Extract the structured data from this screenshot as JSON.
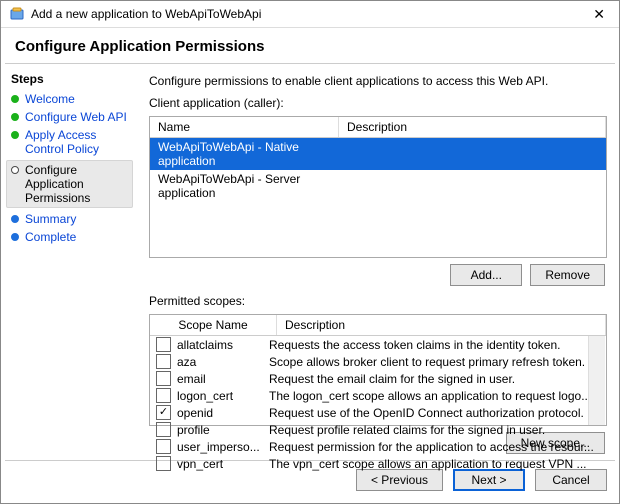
{
  "title": "Add a new application to WebApiToWebApi",
  "header": "Configure Application Permissions",
  "stepsLabel": "Steps",
  "steps": [
    {
      "label": "Welcome",
      "state": "green",
      "link": true
    },
    {
      "label": "Configure Web API",
      "state": "green",
      "link": true
    },
    {
      "label": "Apply Access Control Policy",
      "state": "green",
      "link": true
    },
    {
      "label": "Configure Application Permissions",
      "state": "open",
      "link": false,
      "active": true
    },
    {
      "label": "Summary",
      "state": "blue",
      "link": true
    },
    {
      "label": "Complete",
      "state": "blue",
      "link": true
    }
  ],
  "instruction": "Configure permissions to enable client applications to access this Web API.",
  "clientLabel": "Client application (caller):",
  "clientCols": {
    "name": "Name",
    "desc": "Description"
  },
  "clients": [
    {
      "name": "WebApiToWebApi - Native application",
      "desc": "",
      "selected": true
    },
    {
      "name": "WebApiToWebApi - Server application",
      "desc": "",
      "selected": false
    }
  ],
  "buttons": {
    "add": "Add...",
    "remove": "Remove",
    "newScope": "New scope...",
    "prev": "< Previous",
    "next": "Next >",
    "cancel": "Cancel"
  },
  "scopesLabel": "Permitted scopes:",
  "scopeCols": {
    "name": "Scope Name",
    "desc": "Description"
  },
  "scopes": [
    {
      "name": "allatclaims",
      "desc": "Requests the access token claims in the identity token.",
      "checked": false
    },
    {
      "name": "aza",
      "desc": "Scope allows broker client to request primary refresh token.",
      "checked": false
    },
    {
      "name": "email",
      "desc": "Request the email claim for the signed in user.",
      "checked": false
    },
    {
      "name": "logon_cert",
      "desc": "The logon_cert scope allows an application to request logo...",
      "checked": false
    },
    {
      "name": "openid",
      "desc": "Request use of the OpenID Connect authorization protocol.",
      "checked": true
    },
    {
      "name": "profile",
      "desc": "Request profile related claims for the signed in user.",
      "checked": false
    },
    {
      "name": "user_imperso...",
      "desc": "Request permission for the application to access the resour...",
      "checked": false
    },
    {
      "name": "vpn_cert",
      "desc": "The vpn_cert scope allows an application to request VPN ...",
      "checked": false
    }
  ]
}
